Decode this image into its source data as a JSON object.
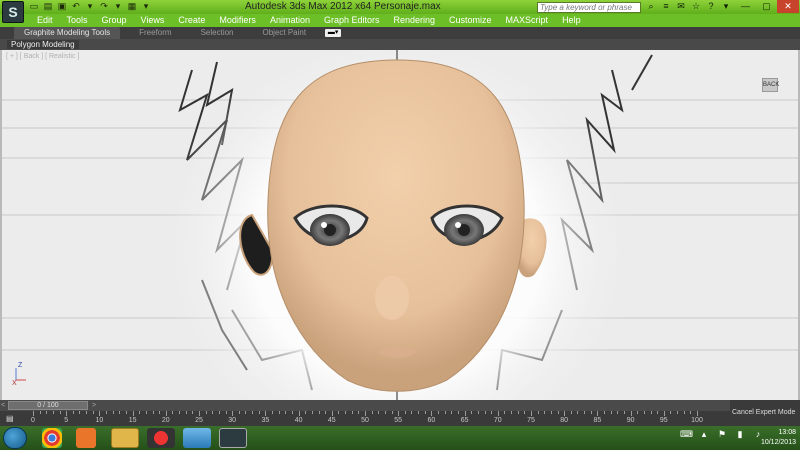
{
  "window": {
    "title": "Autodesk 3ds Max  2012 x64     Personaje.max",
    "logo": "S",
    "search_placeholder": "Type a keyword or phrase"
  },
  "quick_access": [
    {
      "icon": "app-menu-icon"
    },
    {
      "icon": "new-file-icon"
    },
    {
      "icon": "open-file-icon"
    },
    {
      "icon": "save-icon"
    },
    {
      "icon": "undo-icon"
    },
    {
      "icon": "redo-icon"
    },
    {
      "icon": "project-folder-icon"
    },
    {
      "icon": "dropdown-icon"
    }
  ],
  "menu": [
    "Edit",
    "Tools",
    "Group",
    "Views",
    "Create",
    "Modifiers",
    "Animation",
    "Graph Editors",
    "Rendering",
    "Customize",
    "MAXScript",
    "Help"
  ],
  "ribbon": {
    "tabs": [
      "Graphite Modeling Tools",
      "Freeform",
      "Selection",
      "Object Paint"
    ],
    "active_tab": "Graphite Modeling Tools",
    "panel": "Polygon Modeling"
  },
  "viewport": {
    "label": "[ + ] [ Back ] [ Realistic ]",
    "viewcube_label": "BACK",
    "axis_labels": [
      "Z",
      "X"
    ]
  },
  "timeline": {
    "slider_label": "0 / 100",
    "left_arrow": "<",
    "right_arrow": ">",
    "tick_labels": [
      "0",
      "5",
      "10",
      "15",
      "20",
      "25",
      "30",
      "35",
      "40",
      "45",
      "50",
      "55",
      "60",
      "65",
      "70",
      "75",
      "80",
      "85",
      "90",
      "95",
      "100"
    ]
  },
  "status": {
    "cancel_expert": "Cancel Expert Mode"
  },
  "taskbar": {
    "items": [
      {
        "icon": "file-explorer-icon"
      },
      {
        "icon": "chrome-icon"
      },
      {
        "icon": "media-player-icon"
      },
      {
        "icon": "folder-icon"
      },
      {
        "icon": "red-app-icon"
      },
      {
        "icon": "image-viewer-icon"
      },
      {
        "icon": "3dsmax-icon"
      }
    ],
    "time": "13:08",
    "date": "10/12/2013"
  }
}
